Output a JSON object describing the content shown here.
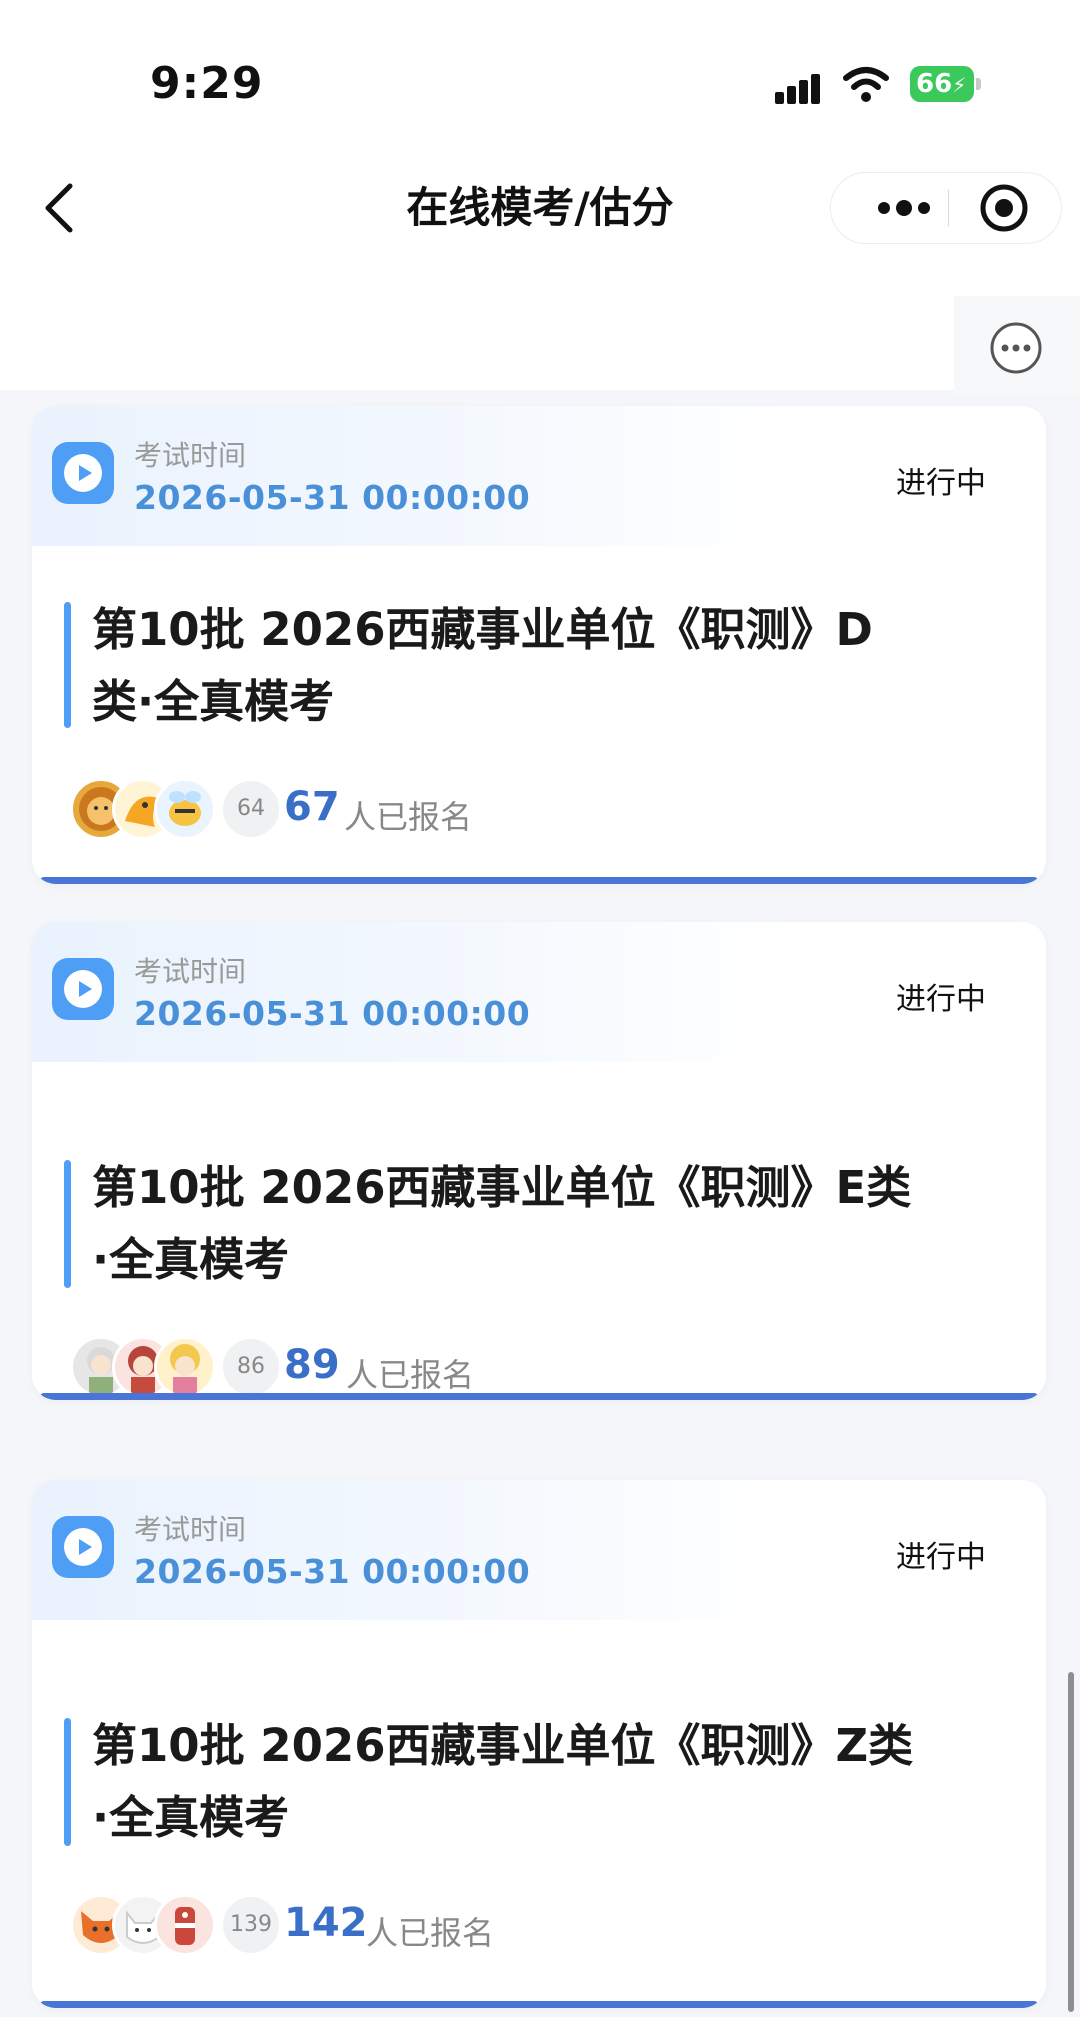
{
  "status_bar": {
    "time": "9:29",
    "battery": "66"
  },
  "nav": {
    "title": "在线模考/估分"
  },
  "cards": [
    {
      "exam_label": "考试时间",
      "exam_time": "2026-05-31 00:00:00",
      "status": "进行中",
      "title_line1": "第10批 2026西藏事业单位《职测》D",
      "title_line2": "类·全真模考",
      "more_count": "64",
      "count": "67",
      "count_suffix": "人已报名"
    },
    {
      "exam_label": "考试时间",
      "exam_time": "2026-05-31 00:00:00",
      "status": "进行中",
      "title_line1": "第10批 2026西藏事业单位《职测》E类",
      "title_line2": "·全真模考",
      "more_count": "86",
      "count": "89",
      "count_suffix": "人已报名"
    },
    {
      "exam_label": "考试时间",
      "exam_time": "2026-05-31 00:00:00",
      "status": "进行中",
      "title_line1": "第10批 2026西藏事业单位《职测》Z类",
      "title_line2": "·全真模考",
      "more_count": "139",
      "count": "142",
      "count_suffix": "人已报名"
    }
  ]
}
